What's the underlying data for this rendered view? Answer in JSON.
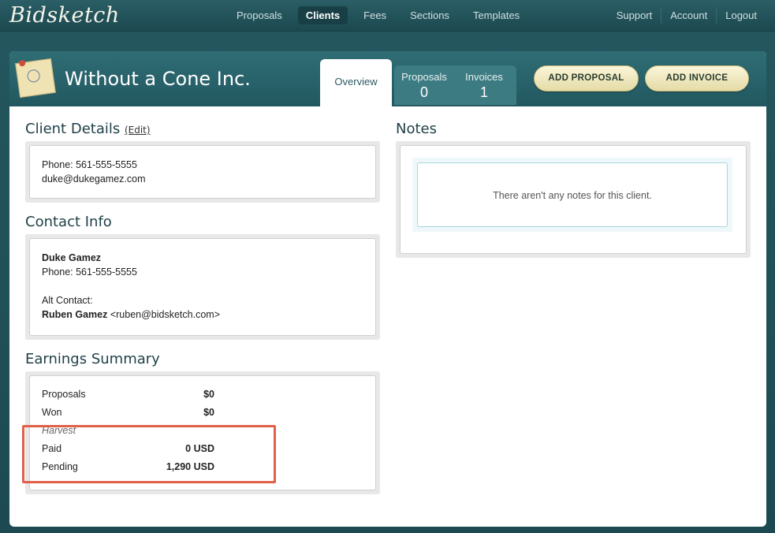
{
  "app": {
    "logo": "Bidsketch"
  },
  "nav": {
    "items": [
      "Proposals",
      "Clients",
      "Fees",
      "Sections",
      "Templates"
    ],
    "active": "Clients",
    "right": [
      "Support",
      "Account",
      "Logout"
    ]
  },
  "client": {
    "name": "Without a Cone Inc."
  },
  "tabs": {
    "overview": "Overview",
    "proposals_label": "Proposals",
    "proposals_count": "0",
    "invoices_label": "Invoices",
    "invoices_count": "1"
  },
  "actions": {
    "add_proposal": "ADD PROPOSAL",
    "add_invoice": "ADD INVOICE"
  },
  "client_details": {
    "title": "Client Details",
    "edit": "(Edit)",
    "phone": "Phone: 561-555-5555",
    "email": "duke@dukegamez.com"
  },
  "contact_info": {
    "title": "Contact Info",
    "name": "Duke Gamez",
    "phone": "Phone: 561-555-5555",
    "alt_label": "Alt Contact:",
    "alt_name": "Ruben Gamez",
    "alt_email": "<ruben@bidsketch.com>"
  },
  "earnings": {
    "title": "Earnings Summary",
    "proposals_label": "Proposals",
    "proposals_value": "$0",
    "won_label": "Won",
    "won_value": "$0",
    "harvest_label": "Harvest",
    "paid_label": "Paid",
    "paid_value": "0 USD",
    "pending_label": "Pending",
    "pending_value": "1,290 USD"
  },
  "notes": {
    "title": "Notes",
    "empty_message": "There aren't any notes for this client."
  },
  "colors": {
    "highlight": "#e0604a",
    "header": "#2f6d75",
    "accent_button": "#f4edc6"
  }
}
